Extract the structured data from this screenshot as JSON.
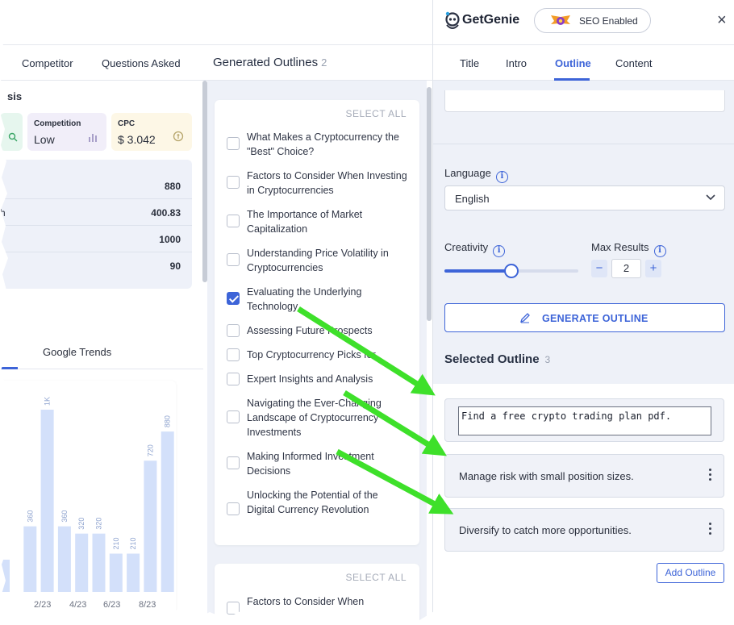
{
  "left_tabs": {
    "competitor": "Competitor",
    "questions": "Questions Asked",
    "generated": "Generated Outlines",
    "generated_count": "2"
  },
  "keyword": {
    "title_fragment": "sis",
    "competition_label": "Competition",
    "competition_value": "Low",
    "cpc_label": "CPC",
    "cpc_value": "$ 3.042",
    "rows": [
      {
        "label": "",
        "value": "880"
      },
      {
        "label": "h",
        "value": "400.83"
      },
      {
        "label": "",
        "value": "1000"
      },
      {
        "label": "",
        "value": "90"
      }
    ]
  },
  "trends": {
    "tab_label": "Google Trends",
    "tick_labels": [
      "2/23",
      "4/23",
      "6/23",
      "8/23"
    ]
  },
  "chart_data": {
    "type": "bar",
    "values": [
      null,
      360,
      1000,
      360,
      320,
      320,
      210,
      210,
      720,
      880
    ],
    "data_labels": [
      "",
      "360",
      "1K",
      "360",
      "320",
      "320",
      "210",
      "210",
      "720",
      "880"
    ],
    "x_tick_labels": [
      "2/23",
      "4/23",
      "6/23",
      "8/23"
    ],
    "bar_color": "#d3e0fa",
    "label_color": "#8ea3cf"
  },
  "outlines": {
    "select_all": "SELECT ALL",
    "items": [
      {
        "text": "What Makes a Cryptocurrency the \"Best\" Choice?",
        "checked": false
      },
      {
        "text": "Factors to Consider When Investing in Cryptocurrencies",
        "checked": false
      },
      {
        "text": "The Importance of Market Capitalization",
        "checked": false
      },
      {
        "text": "Understanding Price Volatility in Cryptocurrencies",
        "checked": false
      },
      {
        "text": "Evaluating the Underlying Technology",
        "checked": true
      },
      {
        "text": "Assessing Future Prospects",
        "checked": false
      },
      {
        "text": "Top Cryptocurrency Picks for",
        "checked": false
      },
      {
        "text": "Expert Insights and Analysis",
        "checked": false
      },
      {
        "text": "Navigating the Ever-Changing Landscape of Cryptocurrency Investments",
        "checked": false
      },
      {
        "text": "Making Informed Investment Decisions",
        "checked": false
      },
      {
        "text": "Unlocking the Potential of the Digital Currency Revolution",
        "checked": false
      }
    ],
    "second_select_all": "SELECT ALL",
    "second_first_item": "Factors to Consider When"
  },
  "panel": {
    "brand": "GetGenie",
    "seo_badge": "SEO Enabled",
    "close_symbol": "×",
    "tabs": [
      "Title",
      "Intro",
      "Outline",
      "Content"
    ],
    "active_tab": "Outline",
    "language_label": "Language",
    "language_value": "English",
    "creativity_label": "Creativity",
    "creativity_level": 0.5,
    "max_results_label": "Max Results",
    "max_results_value": "2",
    "minus": "−",
    "plus": "+",
    "generate_button": "GENERATE OUTLINE",
    "selected_title": "Selected Outline",
    "selected_count": "3",
    "selected_items": [
      "Find a free crypto trading plan pdf.",
      "Manage risk with small position sizes.",
      "Diversify to catch more opportunities."
    ],
    "add_outline": "Add Outline"
  },
  "colors": {
    "accent": "#3d64d8",
    "arrow": "#3ee02a",
    "competition_card": "#f1eef9",
    "cpc_card": "#fdf7e6"
  }
}
